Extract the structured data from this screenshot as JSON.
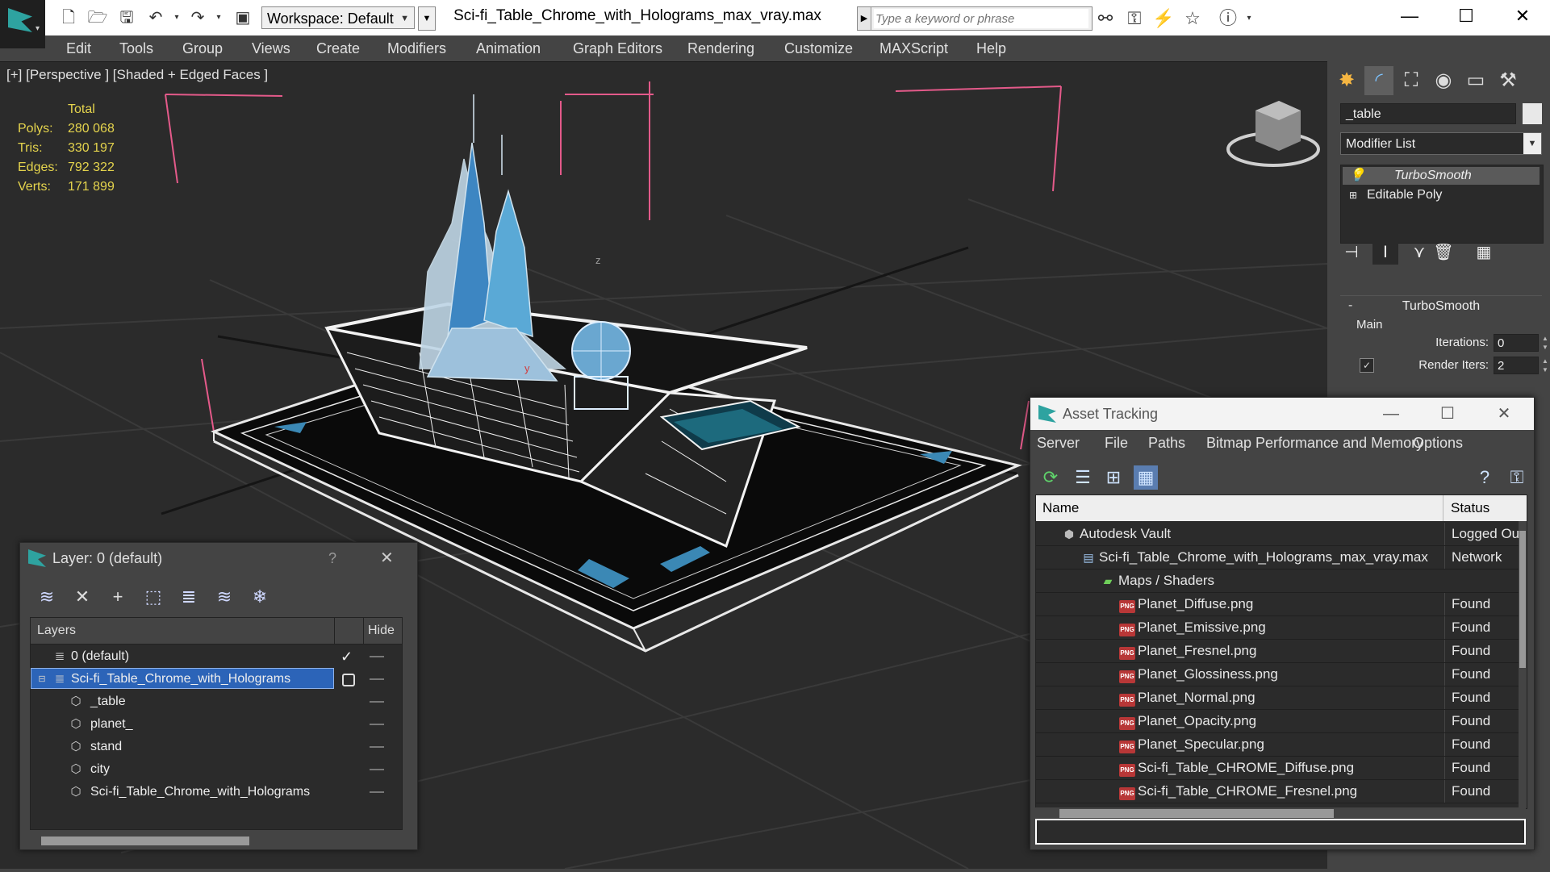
{
  "titlebar": {
    "workspace": "Workspace: Default",
    "document_title": "Sci-fi_Table_Chrome_with_Holograms_max_vray.max",
    "search_placeholder": "Type a keyword or phrase",
    "minimize": "—",
    "maximize": "☐",
    "close": "✕"
  },
  "menu": [
    "Edit",
    "Tools",
    "Group",
    "Views",
    "Create",
    "Modifiers",
    "Animation",
    "Graph Editors",
    "Rendering",
    "Customize",
    "MAXScript",
    "Help"
  ],
  "viewport": {
    "label": "[+] [Perspective ] [Shaded + Edged Faces ]",
    "stats": {
      "header": "Total",
      "rows": [
        {
          "label": "Polys:",
          "value": "280 068"
        },
        {
          "label": "Tris:",
          "value": "330 197"
        },
        {
          "label": "Edges:",
          "value": "792 322"
        },
        {
          "label": "Verts:",
          "value": "171 899"
        }
      ]
    },
    "axis_labels": {
      "z": "z",
      "y": "y"
    },
    "colors": {
      "background": "#2b2b2b",
      "grid": "#3a3a3a",
      "wire": "#e8e8e8",
      "hologram": "#5aa9d6",
      "selection": "#e45a8a",
      "stats": "#e5d44d"
    }
  },
  "command_panel": {
    "object_name": "_table",
    "modifier_list": "Modifier List",
    "stack": [
      "TurboSmooth",
      "Editable Poly"
    ],
    "rollout_title": "TurboSmooth",
    "main_label": "Main",
    "iterations_label": "Iterations:",
    "iterations_value": "0",
    "render_iters_label": "Render Iters:",
    "render_iters_value": "2",
    "render_iters_checked": true
  },
  "layer_window": {
    "title": "Layer: 0 (default)",
    "help": "?",
    "close": "✕",
    "col_layers": "Layers",
    "col_hide": "Hide",
    "rows": [
      {
        "name": "0 (default)",
        "level": 0,
        "type": "layer",
        "active": true,
        "selected": false
      },
      {
        "name": "Sci-fi_Table_Chrome_with_Holograms",
        "level": 0,
        "type": "layer",
        "active": false,
        "selected": true
      },
      {
        "name": "_table",
        "level": 1,
        "type": "object",
        "active": false,
        "selected": false
      },
      {
        "name": "planet_",
        "level": 1,
        "type": "object",
        "active": false,
        "selected": false
      },
      {
        "name": "stand",
        "level": 1,
        "type": "object",
        "active": false,
        "selected": false
      },
      {
        "name": "city",
        "level": 1,
        "type": "object",
        "active": false,
        "selected": false
      },
      {
        "name": "Sci-fi_Table_Chrome_with_Holograms",
        "level": 1,
        "type": "object",
        "active": false,
        "selected": false
      }
    ]
  },
  "asset_tracking": {
    "title": "Asset Tracking",
    "menu": [
      "Server",
      "File",
      "Paths",
      "Bitmap Performance and Memory",
      "Options"
    ],
    "col_name": "Name",
    "col_status": "Status",
    "rows": [
      {
        "name": "Autodesk Vault",
        "status": "Logged Out",
        "level": 0,
        "icon": "vault"
      },
      {
        "name": "Sci-fi_Table_Chrome_with_Holograms_max_vray.max",
        "status": "Network",
        "level": 1,
        "icon": "max"
      },
      {
        "name": "Maps / Shaders",
        "status": "",
        "level": 2,
        "icon": "maps"
      },
      {
        "name": "Planet_Diffuse.png",
        "status": "Found",
        "level": 3,
        "icon": "png"
      },
      {
        "name": "Planet_Emissive.png",
        "status": "Found",
        "level": 3,
        "icon": "png"
      },
      {
        "name": "Planet_Fresnel.png",
        "status": "Found",
        "level": 3,
        "icon": "png"
      },
      {
        "name": "Planet_Glossiness.png",
        "status": "Found",
        "level": 3,
        "icon": "png"
      },
      {
        "name": "Planet_Normal.png",
        "status": "Found",
        "level": 3,
        "icon": "png"
      },
      {
        "name": "Planet_Opacity.png",
        "status": "Found",
        "level": 3,
        "icon": "png"
      },
      {
        "name": "Planet_Specular.png",
        "status": "Found",
        "level": 3,
        "icon": "png"
      },
      {
        "name": "Sci-fi_Table_CHROME_Diffuse.png",
        "status": "Found",
        "level": 3,
        "icon": "png"
      },
      {
        "name": "Sci-fi_Table_CHROME_Fresnel.png",
        "status": "Found",
        "level": 3,
        "icon": "png"
      }
    ]
  }
}
